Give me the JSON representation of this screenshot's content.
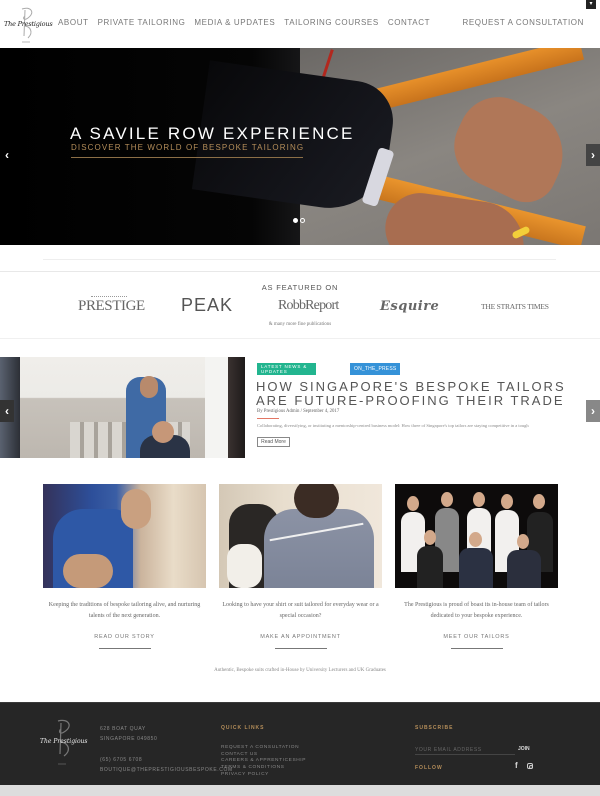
{
  "header": {
    "logo_text": "The Prestigious",
    "nav": [
      "ABOUT",
      "PRIVATE TAILORING",
      "MEDIA & UPDATES",
      "TAILORING COURSES",
      "CONTACT"
    ],
    "cta": "REQUEST A CONSULTATION",
    "corner_icon": "▾"
  },
  "hero": {
    "title": "A SAVILE ROW EXPERIENCE",
    "subtitle": "DISCOVER THE WORLD OF BESPOKE TAILORING",
    "prev_icon": "‹",
    "next_icon": "›",
    "slide_count": 2,
    "active_slide": 1
  },
  "featured": {
    "title": "AS FEATURED ON",
    "publications": [
      "PRESTIGE",
      "PEAK",
      "RobbReport",
      "Esquire",
      "THE STRAITS TIMES"
    ],
    "more": "& many more fine publications"
  },
  "news": {
    "tags": [
      "LATEST NEWS & UPDATES",
      "ON_THE_PRESS"
    ],
    "title": "HOW SINGAPORE'S BESPOKE TAILORS ARE FUTURE-PROOFING THEIR TRADE",
    "meta": "By Prestigious Admin  /  September 4, 2017",
    "excerpt": "Collaborating, diversifying, or instituting a mentorship-centred business model: How three of Singapore's top tailors are staying competitive in a tough",
    "read_more": "Read More",
    "prev_icon": "‹",
    "next_icon": "›"
  },
  "cards": [
    {
      "text": "Keeping the traditions of bespoke tailoring alive, and nurturing talents of the next generation.",
      "link": "READ OUR STORY"
    },
    {
      "text": "Looking to have your shirt or suit tailored for everyday wear or a special occasion?",
      "link": "MAKE AN APPOINTMENT"
    },
    {
      "text": "The Prestigious is proud of boast its in-house team of tailors dedicated to your bespoke experience.",
      "link": "MEET OUR TAILORS"
    }
  ],
  "tagline": "Authentic, Bespoke suits crafted in-House by University Lecturers and UK Graduates",
  "footer": {
    "logo_text": "The Prestigious",
    "address": [
      "628 BOAT QUAY",
      "SINGAPORE 049850"
    ],
    "phone": "(65) 6705 6708",
    "email": "BOUTIQUE@THEPRESTIGIOUSBESPOKE.COM",
    "quick_links_title": "QUICK LINKS",
    "quick_links": [
      "REQUEST A CONSULTATION",
      "CONTACT US",
      "CAREERS & APPRENTICESHIP",
      "TERMS & CONDITIONS",
      "PRIVACY POLICY"
    ],
    "subscribe_title": "SUBSCRIBE",
    "email_placeholder": "YOUR EMAIL ADDRESS",
    "join_label": "JOIN",
    "follow_title": "FOLLOW",
    "social": [
      "facebook",
      "instagram"
    ],
    "facebook_glyph": "f"
  }
}
